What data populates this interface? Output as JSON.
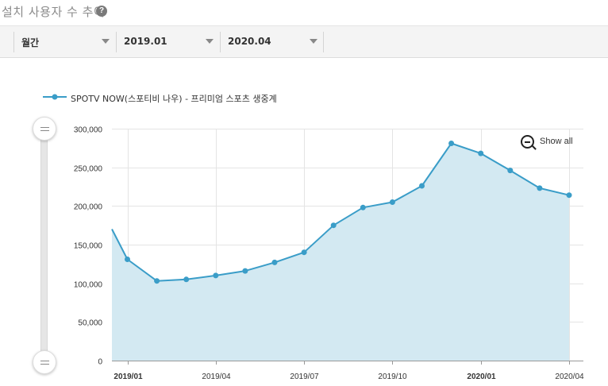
{
  "header": {
    "title": "설치 사용자 수 추이",
    "help_icon": "question-circle-icon"
  },
  "filters": {
    "period": "월간",
    "start": "2019.01",
    "end": "2020.04"
  },
  "toolbar": {
    "show_all_label": "Show all",
    "zoom_icon": "zoom-out-icon"
  },
  "colors": {
    "series_line": "#3a9dc8",
    "series_fill": "#d3e9f2",
    "grid": "#e4e4e4"
  },
  "chart_data": {
    "type": "area",
    "title": "",
    "xlabel": "",
    "ylabel": "",
    "legend_position": "top-left",
    "grid": true,
    "ylim": [
      0,
      300000
    ],
    "y_ticks": [
      "0",
      "50,000",
      "100,000",
      "150,000",
      "200,000",
      "250,000",
      "300,000"
    ],
    "x_tick_labels": [
      "2019/01",
      "2019/04",
      "2019/07",
      "2019/10",
      "2020/01",
      "2020/04"
    ],
    "x": [
      "2018/12",
      "2019/01",
      "2019/02",
      "2019/03",
      "2019/04",
      "2019/05",
      "2019/06",
      "2019/07",
      "2019/08",
      "2019/09",
      "2019/10",
      "2019/11",
      "2019/12",
      "2020/01",
      "2020/02",
      "2020/03",
      "2020/04"
    ],
    "series": [
      {
        "name": "SPOTV NOW(스포티비 나우) - 프리미엄 스포츠 생중계",
        "values": [
          170000,
          131000,
          103000,
          105000,
          110000,
          116000,
          127000,
          140000,
          175000,
          198000,
          205000,
          226000,
          281000,
          268000,
          246000,
          223000,
          214000
        ]
      }
    ]
  }
}
